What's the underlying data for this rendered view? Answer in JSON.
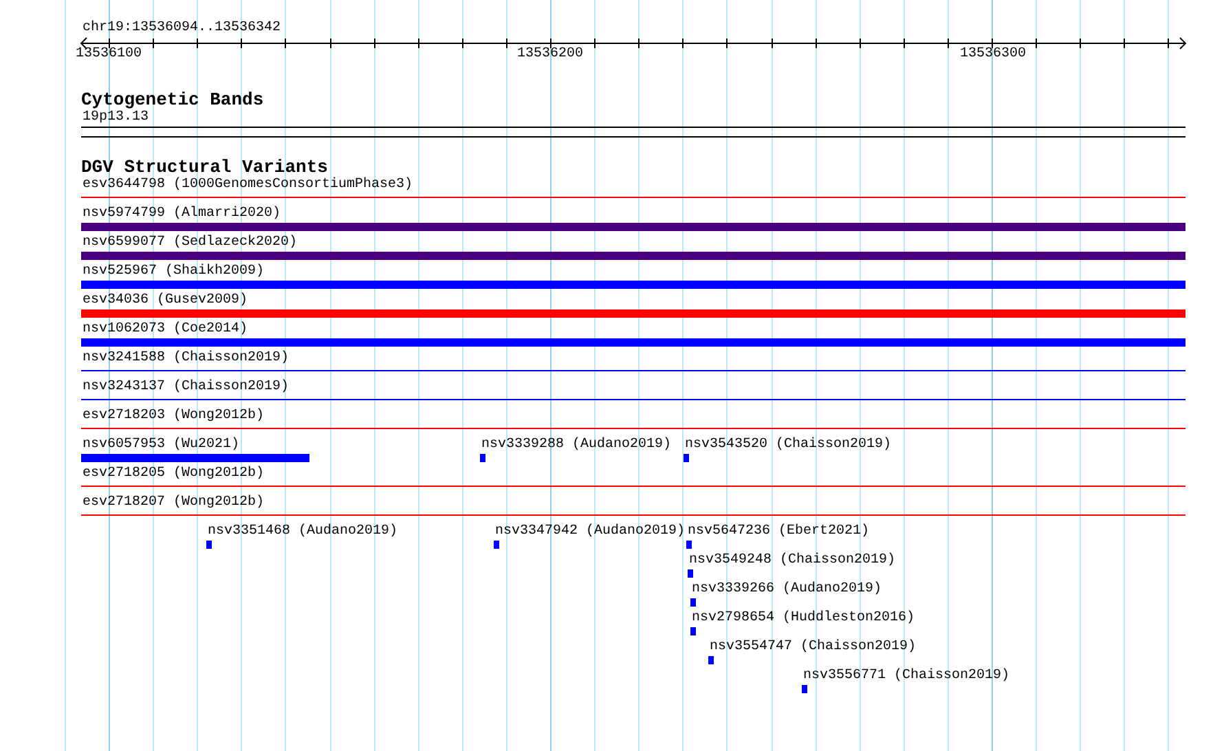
{
  "ruler": {
    "region": "chr19:13536094..13536342",
    "ticks": [
      "13536100",
      "13536200",
      "13536300"
    ]
  },
  "tracks": [
    {
      "title": "Cytogenetic Bands",
      "rows": [
        {
          "features": [
            {
              "label": "19p13.13",
              "kind": "band"
            }
          ]
        }
      ]
    },
    {
      "title": "DGV Structural Variants",
      "rows": [
        {
          "features": [
            {
              "label": "esv3644798 (1000GenomesConsortiumPhase3)",
              "kind": "line",
              "color": "#ff0000"
            }
          ]
        },
        {
          "features": [
            {
              "label": "nsv5974799 (Almarri2020)",
              "kind": "bar",
              "color": "#4b0082"
            }
          ]
        },
        {
          "features": [
            {
              "label": "nsv6599077 (Sedlazeck2020)",
              "kind": "bar",
              "color": "#4b0082"
            }
          ]
        },
        {
          "features": [
            {
              "label": "nsv525967 (Shaikh2009)",
              "kind": "bar",
              "color": "#0000ff"
            }
          ]
        },
        {
          "features": [
            {
              "label": "esv34036 (Gusev2009)",
              "kind": "bar",
              "color": "#ff0000"
            }
          ]
        },
        {
          "features": [
            {
              "label": "nsv1062073 (Coe2014)",
              "kind": "bar",
              "color": "#0000ff"
            }
          ]
        },
        {
          "features": [
            {
              "label": "nsv3241588 (Chaisson2019)",
              "kind": "line",
              "color": "#0000ff"
            }
          ]
        },
        {
          "features": [
            {
              "label": "nsv3243137 (Chaisson2019)",
              "kind": "line",
              "color": "#0000ff"
            }
          ]
        },
        {
          "features": [
            {
              "label": "esv2718203 (Wong2012b)",
              "kind": "line",
              "color": "#ff0000"
            }
          ]
        },
        {
          "features": [
            {
              "label": "nsv6057953 (Wu2021)",
              "kind": "bar",
              "color": "#0000ff"
            },
            {
              "label": "nsv3339288 (Audano2019)",
              "kind": "bar",
              "color": "#0000ff"
            },
            {
              "label": "nsv3543520 (Chaisson2019)",
              "kind": "bar",
              "color": "#0000ff"
            }
          ]
        },
        {
          "features": [
            {
              "label": "esv2718205 (Wong2012b)",
              "kind": "line",
              "color": "#ff0000"
            }
          ]
        },
        {
          "features": [
            {
              "label": "esv2718207 (Wong2012b)",
              "kind": "line",
              "color": "#ff0000"
            }
          ]
        },
        {
          "features": [
            {
              "label": "nsv3351468 (Audano2019)",
              "kind": "bar",
              "color": "#0000ff"
            },
            {
              "label": "nsv3347942 (Audano2019)",
              "kind": "bar",
              "color": "#0000ff"
            },
            {
              "label": "nsv5647236 (Ebert2021)",
              "kind": "bar",
              "color": "#0000ff"
            }
          ]
        },
        {
          "features": [
            {
              "label": "nsv3549248 (Chaisson2019)",
              "kind": "bar",
              "color": "#0000ff"
            }
          ]
        },
        {
          "features": [
            {
              "label": "nsv3339266 (Audano2019)",
              "kind": "bar",
              "color": "#0000ff"
            }
          ]
        },
        {
          "features": [
            {
              "label": "nsv2798654 (Huddleston2016)",
              "kind": "bar",
              "color": "#0000ff"
            }
          ]
        },
        {
          "features": [
            {
              "label": "nsv3554747 (Chaisson2019)",
              "kind": "bar",
              "color": "#0000ff"
            }
          ]
        },
        {
          "features": [
            {
              "label": "nsv3556771 (Chaisson2019)",
              "kind": "bar",
              "color": "#0000ff"
            }
          ]
        }
      ]
    }
  ]
}
